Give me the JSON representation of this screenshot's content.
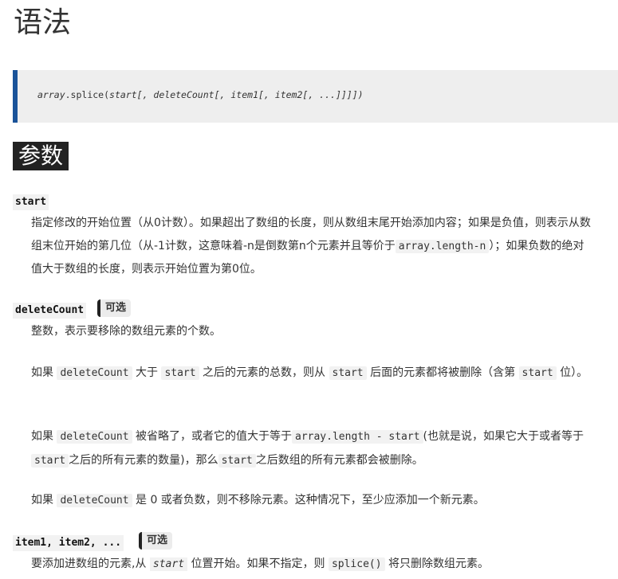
{
  "heading_syntax": "语法",
  "syntax": {
    "obj": "array",
    "method": ".splice(",
    "start": "start",
    "sep1": "[, ",
    "deleteCount": "deleteCount",
    "sep2": "[, ",
    "item1": "item1",
    "sep3": "[, ",
    "item2": "item2",
    "rest": "[, ...]]]])"
  },
  "heading_params": "参数",
  "optional_label": "可选",
  "start": {
    "term": "start",
    "t1": "指定修改的开始位置（从0计数）。如果超出了数组的长度，则从数组末尾开始添加内容；如果是负值，则表示从数组末位开始的第几位（从-1计数，这意味着-n是倒数第n个元素并且等价于",
    "code1": "array.length-n",
    "t2": "）；如果负数的绝对值大于数组的长度，则表示开始位置为第0位。"
  },
  "deleteCount": {
    "term": "deleteCount",
    "p1": "整数，表示要移除的数组元素的个数。",
    "p2": {
      "t1": "如果 ",
      "c1": "deleteCount",
      "t2": " 大于 ",
      "c2": "start",
      "t3": " 之后的元素的总数，则从 ",
      "c3": "start",
      "t4": " 后面的元素都将被删除（含第 ",
      "c4": "start",
      "t5": " 位）。"
    },
    "p3": {
      "t1": "如果 ",
      "c1": "deleteCount",
      "t2": " 被省略了，或者它的值大于等于",
      "c2": "array.length - start",
      "t3": "(也就是说，如果它大于或者等于",
      "c3": "start",
      "t4": "之后的所有元素的数量)，那么",
      "c4": "start",
      "t5": "之后数组的所有元素都会被删除。"
    },
    "p4": {
      "t1": "如果 ",
      "c1": "deleteCount",
      "t2": " 是 0 或者负数，则不移除元素。这种情况下，至少应添加一个新元素。"
    }
  },
  "items": {
    "term": "item1, item2, ...",
    "t1": "要添加进数组的元素,从 ",
    "e1": "start",
    "t2": " 位置开始。如果不指定，则 ",
    "c1": "splice()",
    "t3": " 将只删除数组元素。"
  }
}
